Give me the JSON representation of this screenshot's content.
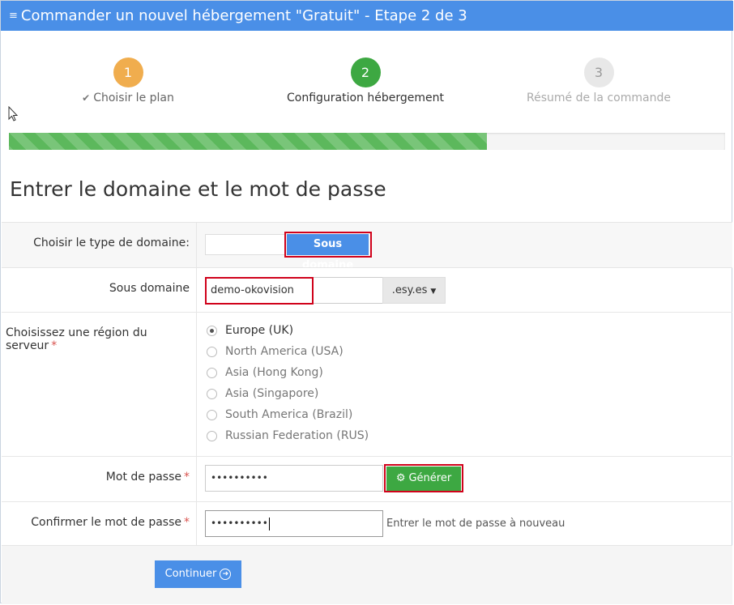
{
  "header": {
    "title": "Commander un nouvel hébergement \"Gratuit\" - Etape 2 de 3",
    "menu_icon": "menu-icon"
  },
  "steps": [
    {
      "number": "1",
      "label": "Choisir le plan",
      "color": "#f0ad4e",
      "icon": "check-icon"
    },
    {
      "number": "2",
      "label": "Configuration hébergement",
      "color": "#3da842"
    },
    {
      "number": "3",
      "label": "Résumé de la commande",
      "color": "#e8e8e8"
    }
  ],
  "progress": {
    "percent": 66.7
  },
  "section_title": "Entrer le domaine et le mot de passe",
  "form": {
    "domain_type": {
      "label": "Choisir le type de domaine:",
      "option": "Sous domaine"
    },
    "subdomain": {
      "label": "Sous domaine",
      "value": "demo-okovision",
      "suffix": ".esy.es"
    },
    "region": {
      "label": "Choisissez une région du serveur",
      "options": [
        "Europe (UK)",
        "North America (USA)",
        "Asia (Hong Kong)",
        "Asia (Singapore)",
        "South America (Brazil)",
        "Russian Federation (RUS)"
      ],
      "selected": "Europe (UK)"
    },
    "password": {
      "label": "Mot de passe",
      "value": "••••••••••",
      "generate_label": "Générer"
    },
    "confirm": {
      "label": "Confirmer le mot de passe",
      "value": "••••••••••",
      "help": "Entrer le mot de passe à nouveau"
    },
    "required_mark": "*"
  },
  "footer": {
    "continue_label": "Continuer"
  },
  "colors": {
    "header": "#4a8fe7",
    "primary": "#4a8fe7",
    "success": "#3da842",
    "highlight": "#d0021b"
  }
}
